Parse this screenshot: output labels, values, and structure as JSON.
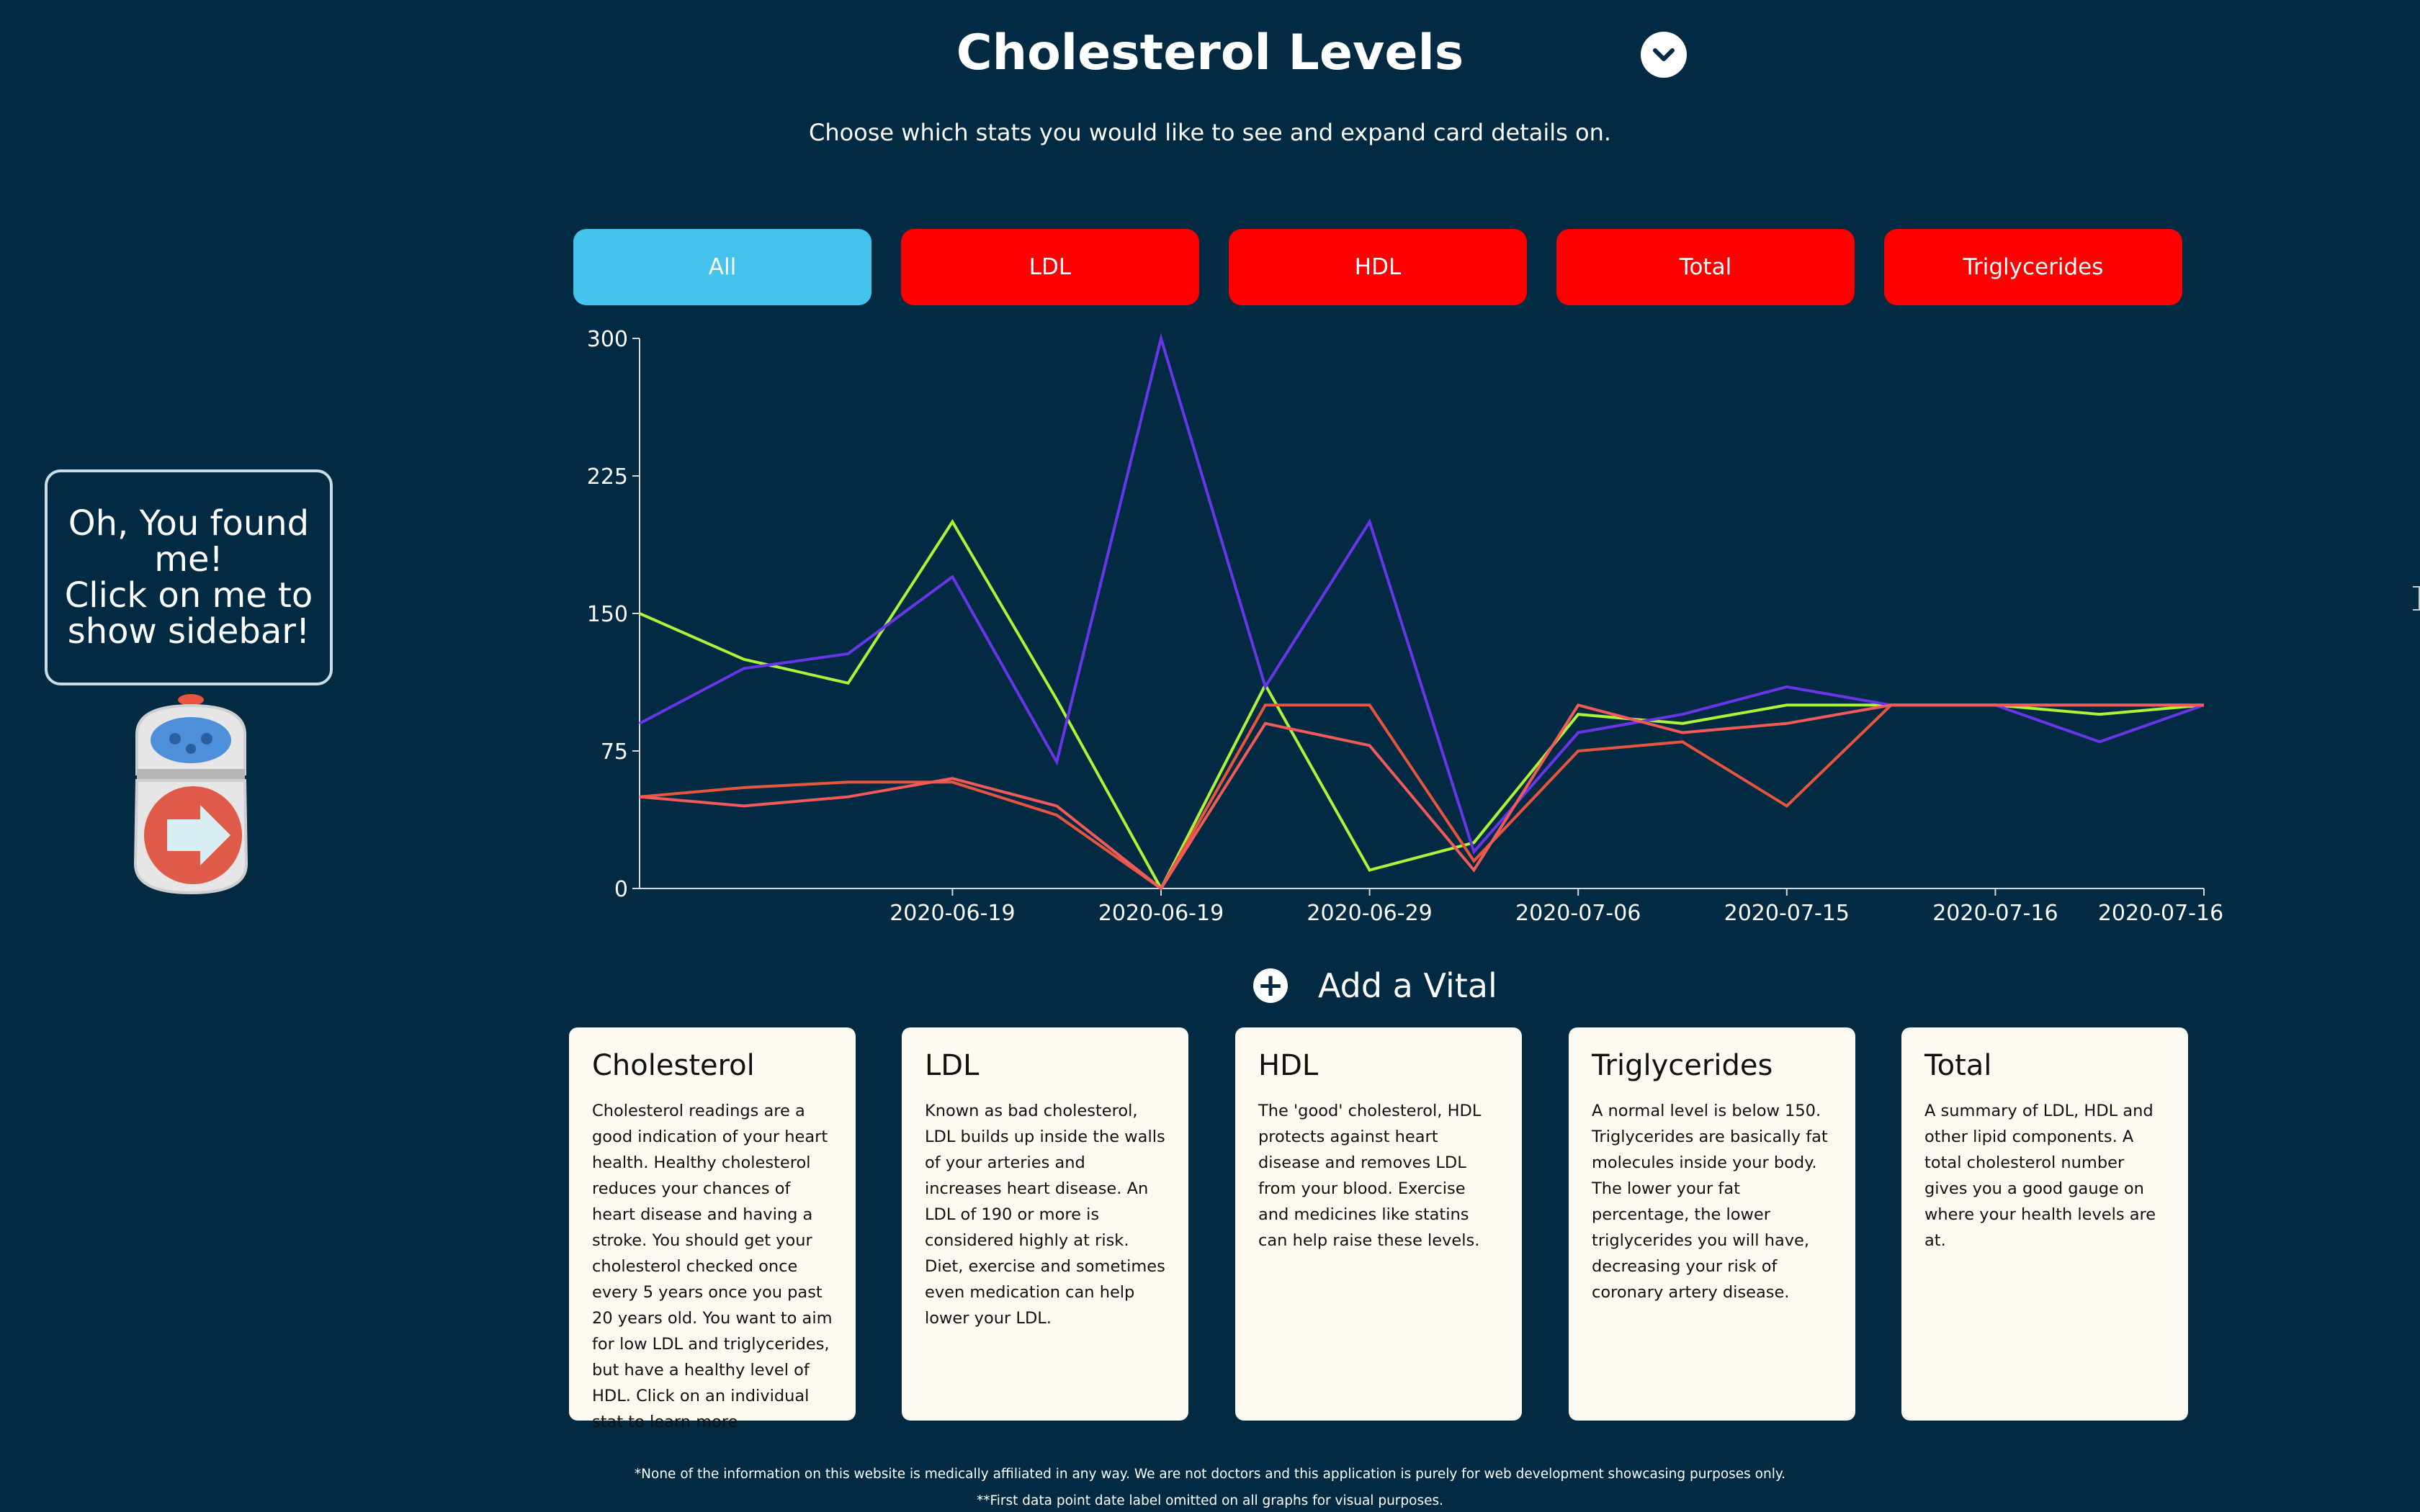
{
  "header": {
    "title": "Cholesterol Levels",
    "subtitle": "Choose which stats you would like to see and expand card details on."
  },
  "tabs": [
    {
      "label": "All",
      "color": "#43c3ee",
      "active": true
    },
    {
      "label": "LDL",
      "color": "#ff0000",
      "active": false
    },
    {
      "label": "HDL",
      "color": "#ff0000",
      "active": false
    },
    {
      "label": "Total",
      "color": "#ff0000",
      "active": false
    },
    {
      "label": "Triglycerides",
      "color": "#ff0000",
      "active": false
    }
  ],
  "helper": {
    "bubble_line1": "Oh, You found me!",
    "bubble_line2": "Click on me to",
    "bubble_line3": "show sidebar!"
  },
  "chart_data": {
    "type": "line",
    "title": "",
    "xlabel": "",
    "ylabel": "",
    "ylim": [
      0,
      300
    ],
    "y_ticks": [
      "0",
      "75",
      "150",
      "225",
      "300"
    ],
    "x_tick_labels": [
      "2020-06-19",
      "2020-06-19",
      "2020-06-29",
      "2020-07-06",
      "2020-07-15",
      "2020-07-16",
      "2020-07-16"
    ],
    "series": [
      {
        "color": "#aef23a",
        "values": [
          150,
          125,
          112,
          200,
          103,
          0,
          111,
          10,
          25,
          95,
          90,
          100,
          100,
          100,
          95,
          100
        ]
      },
      {
        "color": "#6a35e6",
        "values": [
          90,
          120,
          128,
          170,
          69,
          300,
          110,
          200,
          20,
          85,
          95,
          110,
          100,
          100,
          80,
          100
        ]
      },
      {
        "color": "#e8553e",
        "values": [
          50,
          55,
          58,
          58,
          40,
          0,
          100,
          100,
          15,
          75,
          80,
          45,
          100,
          100,
          100,
          100
        ]
      },
      {
        "color": "#f25a5a",
        "values": [
          50,
          45,
          50,
          60,
          45,
          0,
          90,
          78,
          10,
          100,
          85,
          90,
          100,
          100,
          100,
          100
        ]
      }
    ],
    "grid": false,
    "legend": "none"
  },
  "add_vital": {
    "label": "Add a Vital"
  },
  "cards": [
    {
      "title": "Cholesterol",
      "body": "Cholesterol readings are a good indication of your heart health. Healthy cholesterol reduces your chances of heart disease and having a stroke. You should get your cholesterol checked once every 5 years once you past 20 years old. You want to aim for low LDL and triglycerides, but have a healthy level of HDL. Click on an individual stat to learn more"
    },
    {
      "title": "LDL",
      "body": "Known as bad cholesterol, LDL builds up inside the walls of your arteries and increases heart disease. An LDL of 190 or more is considered highly at risk. Diet, exercise and sometimes even medication can help lower your LDL."
    },
    {
      "title": "HDL",
      "body": "The 'good' cholesterol, HDL protects against heart disease and removes LDL from your blood. Exercise and medicines like statins can help raise these levels."
    },
    {
      "title": "Triglycerides",
      "body": "A normal level is below 150. Triglycerides are basically fat molecules inside your body. The lower your fat percentage, the lower triglycerides you will have, decreasing your risk of coronary artery disease."
    },
    {
      "title": "Total",
      "body": "A summary of LDL, HDL and other lipid components. A total cholesterol number gives you a good gauge on where your health levels are at."
    }
  ],
  "footer": {
    "disclaimer": "*None of the information on this website is medically affiliated in any way. We are not doctors and this application is purely for web development showcasing purposes only.",
    "note": "**First data point date label omitted on all graphs for visual purposes."
  }
}
